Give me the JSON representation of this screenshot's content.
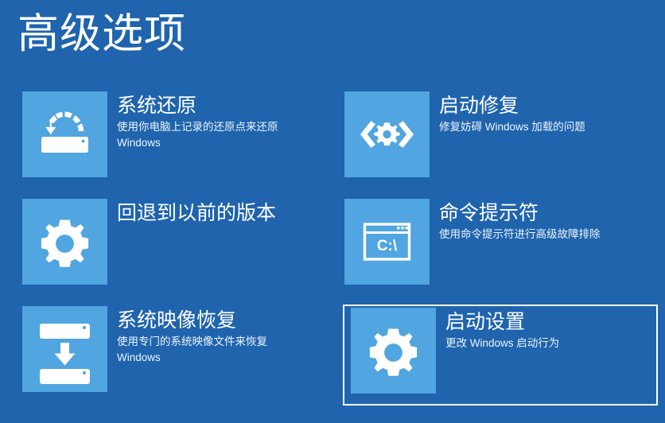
{
  "page": {
    "title": "高级选项",
    "background_color": "#1f64ad",
    "tile_color": "#51a5e0",
    "text_color": "#ffffff",
    "selection_border_color": "#ffffff"
  },
  "options": [
    {
      "id": "system-restore",
      "title": "系统还原",
      "description": "使用你电脑上记录的还原点来还原 Windows",
      "icon": "system-restore-icon",
      "selected": false
    },
    {
      "id": "startup-repair",
      "title": "启动修复",
      "description": "修复妨碍 Windows 加载的问题",
      "icon": "startup-repair-icon",
      "selected": false
    },
    {
      "id": "go-back-previous-build",
      "title": "回退到以前的版本",
      "description": "",
      "icon": "gear-icon",
      "selected": false
    },
    {
      "id": "command-prompt",
      "title": "命令提示符",
      "description": "使用命令提示符进行高级故障排除",
      "icon": "command-prompt-icon",
      "selected": false
    },
    {
      "id": "system-image-recovery",
      "title": "系统映像恢复",
      "description": "使用专门的系统映像文件来恢复 Windows",
      "icon": "system-image-recovery-icon",
      "selected": false
    },
    {
      "id": "startup-settings",
      "title": "启动设置",
      "description": "更改 Windows 启动行为",
      "icon": "gear-icon",
      "selected": true
    }
  ]
}
